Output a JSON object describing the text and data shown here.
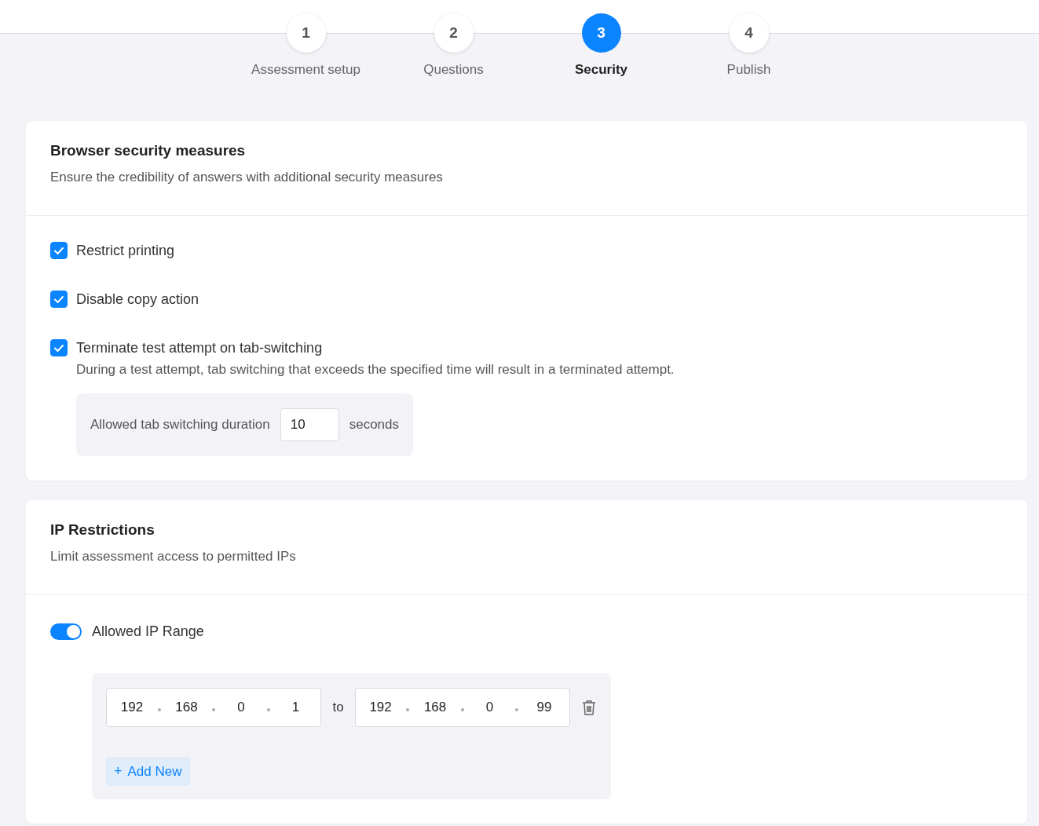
{
  "steps": [
    {
      "number": "1",
      "label": "Assessment setup",
      "selected": false
    },
    {
      "number": "2",
      "label": "Questions",
      "selected": false
    },
    {
      "number": "3",
      "label": "Security",
      "selected": true
    },
    {
      "number": "4",
      "label": "Publish",
      "selected": false
    }
  ],
  "browser_security": {
    "title": "Browser security measures",
    "subtitle": "Ensure the credibility of answers with additional security measures",
    "options": [
      {
        "label": "Restrict printing",
        "checked": true
      },
      {
        "label": "Disable copy action",
        "checked": true
      },
      {
        "label": "Terminate test attempt on tab-switching",
        "checked": true,
        "description": "During a test attempt, tab switching that exceeds the specified time will result in a terminated attempt.",
        "duration": {
          "label": "Allowed tab switching duration",
          "value": "10",
          "unit": "seconds"
        }
      }
    ]
  },
  "ip_restrictions": {
    "title": "IP Restrictions",
    "subtitle": "Limit assessment access to permitted IPs",
    "toggle": {
      "label": "Allowed IP Range",
      "on": true
    },
    "ranges": [
      {
        "from": [
          "192",
          "168",
          "0",
          "1"
        ],
        "separator": "to",
        "to": [
          "192",
          "168",
          "0",
          "99"
        ]
      }
    ],
    "add_button": {
      "icon": "+",
      "label": "Add New"
    }
  }
}
